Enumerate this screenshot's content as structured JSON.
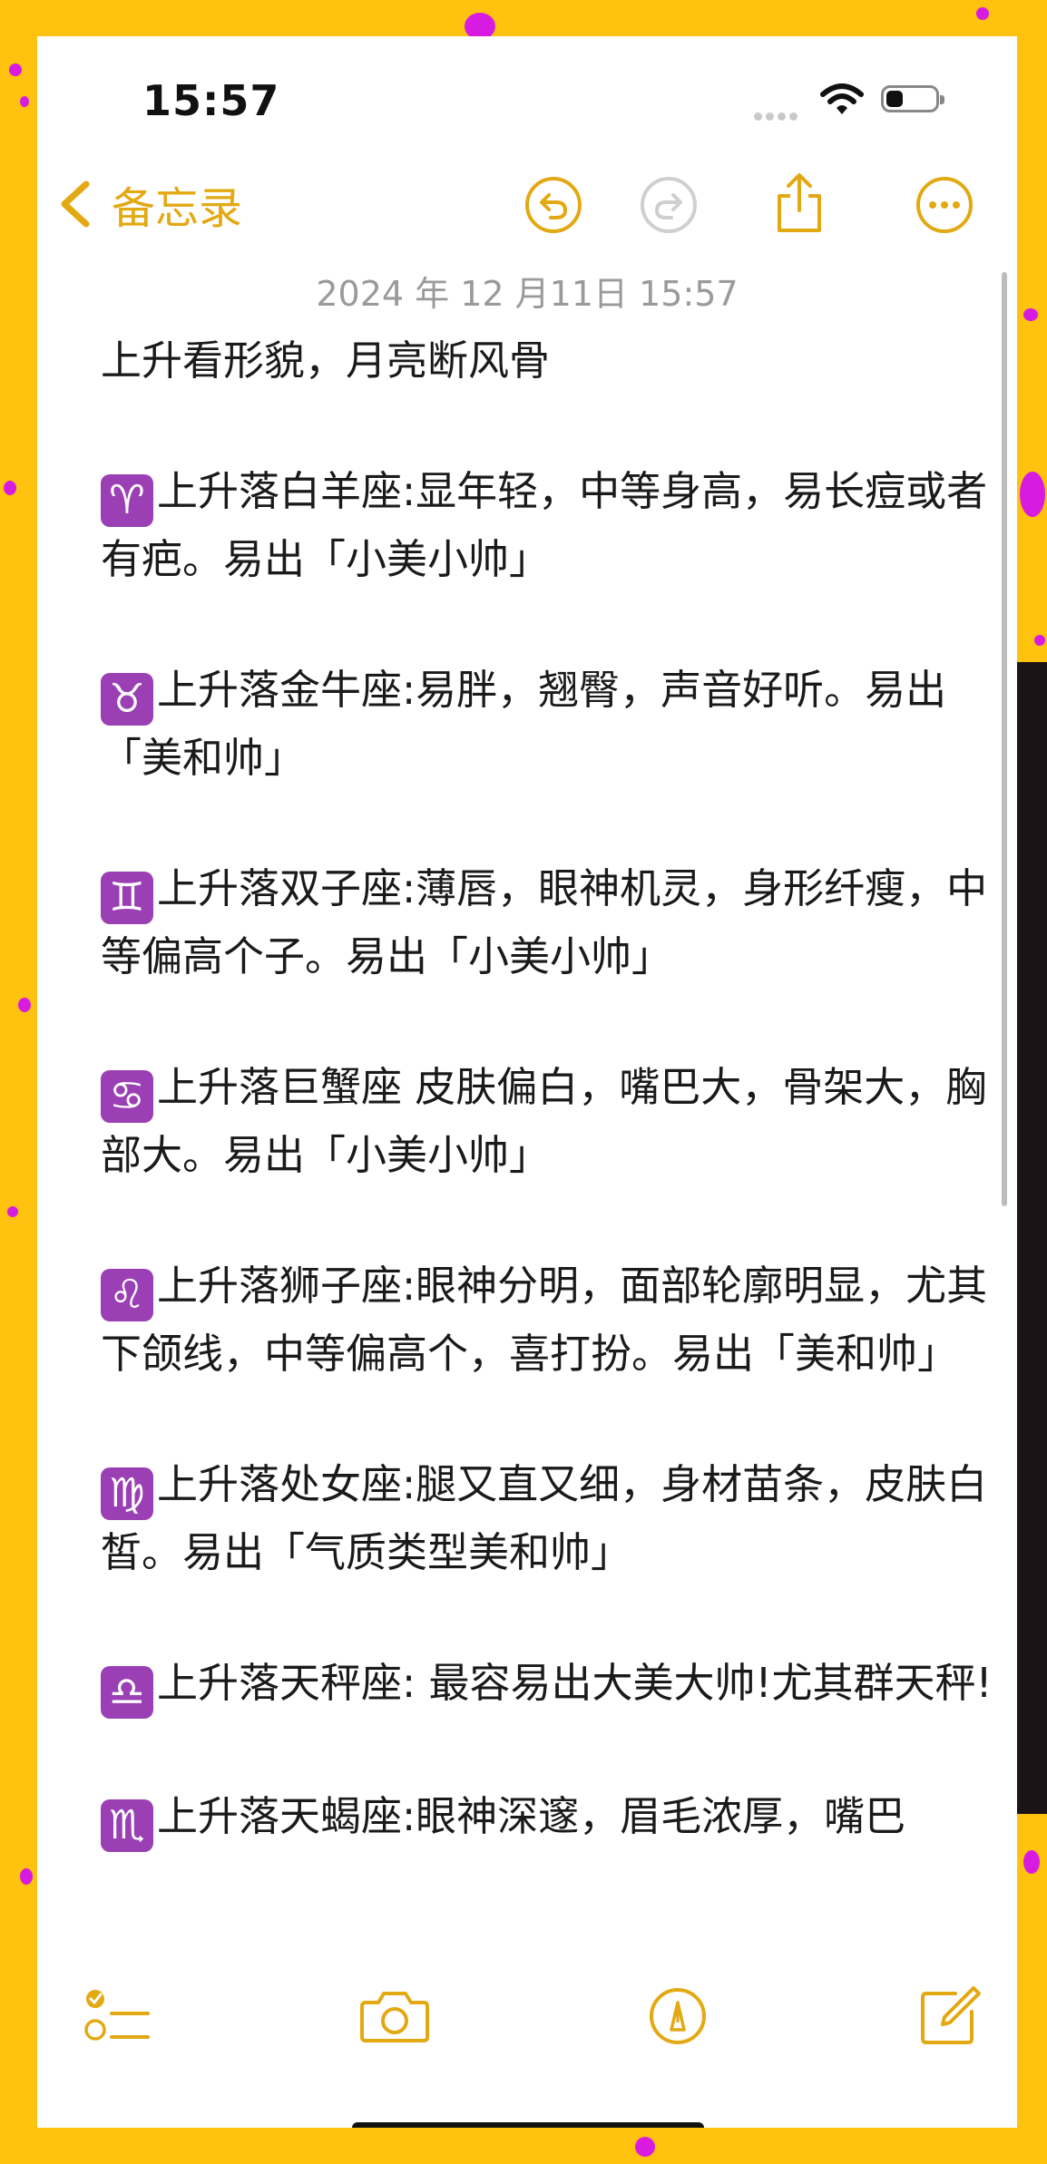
{
  "status_bar": {
    "time": "15:57",
    "battery_level": 0.35
  },
  "nav": {
    "back_label": "备忘录"
  },
  "note": {
    "date": "2024 年 12 月11日 15:57",
    "title_line": "上升看形貌，月亮断风骨",
    "entries": [
      {
        "symbol": "♈",
        "text": "上升落白羊座:显年轻，中等身高，易长痘或者有疤。易出「小美小帅」"
      },
      {
        "symbol": "♉",
        "text": "上升落金牛座:易胖，翘臀，声音好听。易出「美和帅」"
      },
      {
        "symbol": "♊",
        "text": "上升落双子座:薄唇，眼神机灵，身形纤瘦，中等偏高个子。易出「小美小帅」"
      },
      {
        "symbol": "♋",
        "text": "上升落巨蟹座 皮肤偏白，嘴巴大，骨架大，胸部大。易出「小美小帅」"
      },
      {
        "symbol": "♌",
        "text": "上升落狮子座:眼神分明，面部轮廓明显，尤其下颌线，中等偏高个，喜打扮。易出「美和帅」"
      },
      {
        "symbol": "♍",
        "text": "上升落处女座:腿又直又细，身材苗条，皮肤白皙。易出「气质类型美和帅」"
      },
      {
        "symbol": "♎",
        "text": "上升落天秤座: 最容易出大美大帅!尤其群天秤!"
      },
      {
        "symbol": "♏",
        "text": "上升落天蝎座:眼神深邃，眉毛浓厚，嘴巴"
      }
    ]
  },
  "icons": {
    "back": "chevron-left-icon",
    "undo": "undo-icon",
    "redo": "redo-icon",
    "share": "share-icon",
    "more": "more-icon",
    "checklist": "checklist-icon",
    "camera": "camera-icon",
    "markup": "markup-pen-icon",
    "compose": "compose-icon"
  },
  "colors": {
    "accent": "#E3A913",
    "background": "#FFC20E",
    "dots": "#D81BE0",
    "zodiac_badge": "#9b3fb5"
  }
}
